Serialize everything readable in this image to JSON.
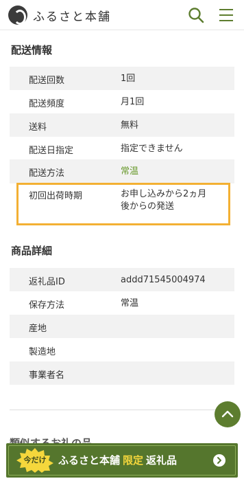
{
  "header": {
    "logo_text": "ふるさと本舗"
  },
  "delivery": {
    "title": "配送情報",
    "rows": [
      {
        "label": "配送回数",
        "value": "1回"
      },
      {
        "label": "配送頻度",
        "value": "月1回"
      },
      {
        "label": "送料",
        "value": "無料"
      },
      {
        "label": "配送日指定",
        "value": "指定できません"
      },
      {
        "label": "配送方法",
        "value": "常温"
      },
      {
        "label": "初回出荷時期",
        "value_line1": "お申し込みから2ヵ月",
        "value_line2": "後からの発送"
      }
    ]
  },
  "product": {
    "title": "商品詳細",
    "rows": [
      {
        "label": "返礼品ID",
        "value": "addd71545004974"
      },
      {
        "label": "保存方法",
        "value": "常温"
      },
      {
        "label": "産地",
        "value": ""
      },
      {
        "label": "製造地",
        "value": ""
      },
      {
        "label": "事業者名",
        "value": ""
      }
    ]
  },
  "related": {
    "title": "類似するお礼の品"
  },
  "banner": {
    "badge": "今だけ",
    "brand": "ふるさと本舗",
    "limited": "限定",
    "tail": "返礼品"
  },
  "colors": {
    "accent_green": "#5d7d2f",
    "highlight": "#f3b033",
    "shipping_method_green": "#6a9a2e"
  },
  "icons": {
    "search": "search-icon",
    "menu": "menu-icon",
    "scroll_top": "chevron-up-icon",
    "banner_arrow": "chevron-right-icon"
  }
}
